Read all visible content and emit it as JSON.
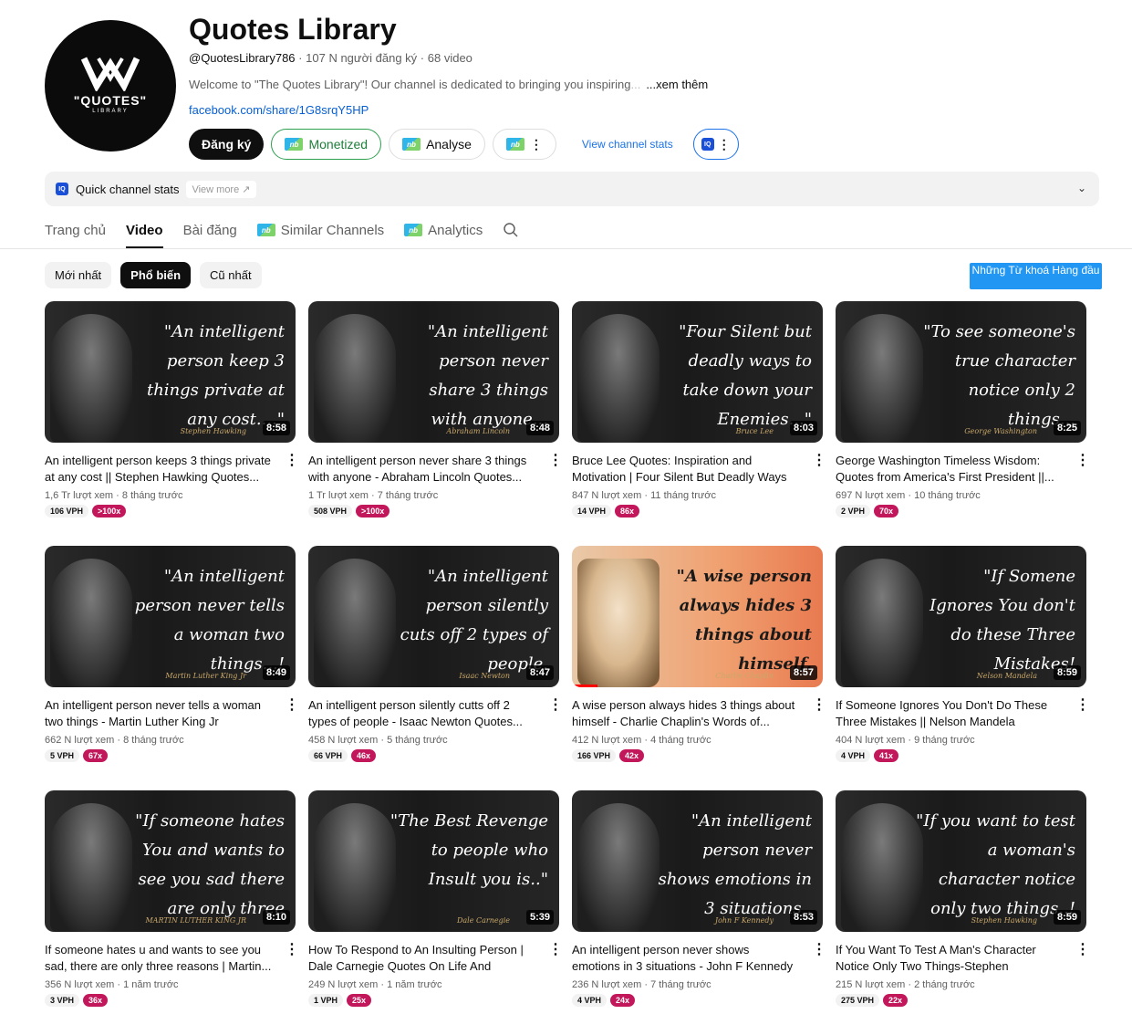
{
  "channel": {
    "title": "Quotes Library",
    "handle": "@QuotesLibrary786",
    "subscribers": "107 N người đăng ký",
    "video_count": "68 video",
    "sep": "·",
    "description": "Welcome to \"The Quotes Library\"! Our channel is dedicated to bringing you inspiring",
    "desc_fade": "...",
    "desc_more": "...xem thêm",
    "link": "facebook.com/share/1G8srqY5HP",
    "avatar_text": "\"QUOTES\"",
    "avatar_sub": "LIBRARY"
  },
  "buttons": {
    "subscribe": "Đăng ký",
    "monetized": "Monetized",
    "analyse": "Analyse",
    "view_stats": "View channel stats",
    "more": "⋮",
    "nb": "nb"
  },
  "stats_bar": {
    "label": "Quick channel stats",
    "view_more": "View more"
  },
  "tabs": [
    "Trang chủ",
    "Video",
    "Bài đăng",
    "Similar Channels",
    "Analytics"
  ],
  "chips": [
    "Mới nhất",
    "Phổ biến",
    "Cũ nhất"
  ],
  "keyword_button": "Những Từ khoá Hàng đầu",
  "videos": [
    {
      "title": "An intelligent person keeps 3 things private at any cost || Stephen Hawking Quotes...",
      "views": "1,6 Tr lượt xem",
      "age": "8 tháng trước",
      "vph": "106 VPH",
      "mult": ">100x",
      "dur": "8:58",
      "quote": "\"An intelligent person keep 3 things private at any cost....\"",
      "sig": "Stephen Hawking"
    },
    {
      "title": "An intelligent person never share 3 things with anyone - Abraham Lincoln Quotes...",
      "views": "1 Tr lượt xem",
      "age": "7 tháng trước",
      "vph": "508 VPH",
      "mult": ">100x",
      "dur": "8:48",
      "quote": "\"An intelligent person never share 3 things with anyone...",
      "sig": "Abraham Lincoln"
    },
    {
      "title": "Bruce Lee Quotes: Inspiration and Motivation | Four Silent But Deadly Ways To...",
      "views": "847 N lượt xem",
      "age": "11 tháng trước",
      "vph": "14 VPH",
      "mult": "86x",
      "dur": "8:03",
      "quote": "\"Four Silent but deadly ways to take down your Enemies...\"",
      "sig": "Bruce Lee"
    },
    {
      "title": "George Washington Timeless Wisdom: Quotes from America's First President ||...",
      "views": "697 N lượt xem",
      "age": "10 tháng trước",
      "vph": "2 VPH",
      "mult": "70x",
      "dur": "8:25",
      "quote": "\"To see someone's true character notice only 2 things...",
      "sig": "George Washington"
    },
    {
      "title": "An intelligent person never tells a woman two things - Martin Luther King Jr Powerful...",
      "views": "662 N lượt xem",
      "age": "8 tháng trước",
      "vph": "5 VPH",
      "mult": "67x",
      "dur": "8:49",
      "quote": "\"An intelligent person never tells a woman two things...!",
      "sig": "Martin Luther King Jr"
    },
    {
      "title": "An intelligent person silently cutts off 2 types of people - Isaac Newton Quotes...",
      "views": "458 N lượt xem",
      "age": "5 tháng trước",
      "vph": "66 VPH",
      "mult": "46x",
      "dur": "8:47",
      "quote": "\"An intelligent person silently cuts off 2 types of people.",
      "sig": "Isaac Newton"
    },
    {
      "title": "A wise person always hides 3 things about himself - Charlie Chaplin's Words of...",
      "views": "412 N lượt xem",
      "age": "4 tháng trước",
      "vph": "166 VPH",
      "mult": "42x",
      "dur": "8:57",
      "quote": "\"A wise person always hides 3 things about himself.",
      "sig": "Charlie Chaplin"
    },
    {
      "title": "If Someone Ignores You Don't Do These Three Mistakes || Nelson Mandela Quotes...",
      "views": "404 N lượt xem",
      "age": "9 tháng trước",
      "vph": "4 VPH",
      "mult": "41x",
      "dur": "8:59",
      "quote": "\"If Somene Ignores You don't do these Three Mistakes!",
      "sig": "Nelson Mandela"
    },
    {
      "title": "If someone hates u and wants to see you sad, there are only three reasons | Martin...",
      "views": "356 N lượt xem",
      "age": "1 năm trước",
      "vph": "3 VPH",
      "mult": "36x",
      "dur": "8:10",
      "quote": "\"If someone hates You and wants to see you sad there are only three reasons.",
      "sig": "MARTIN LUTHER KING JR"
    },
    {
      "title": "How To Respond to An Insulting Person | Dale Carnegie Quotes On Life And Success...",
      "views": "249 N lượt xem",
      "age": "1 năm trước",
      "vph": "1 VPH",
      "mult": "25x",
      "dur": "5:39",
      "quote": "\"The Best Revenge to people who Insult you is..\"",
      "sig": "Dale Carnegie"
    },
    {
      "title": "An intelligent person never shows emotions in 3 situations - John F Kennedy Quotes...",
      "views": "236 N lượt xem",
      "age": "7 tháng trước",
      "vph": "4 VPH",
      "mult": "24x",
      "dur": "8:53",
      "quote": "\"An intelligent person never shows emotions in 3 situations .",
      "sig": "John F Kennedy"
    },
    {
      "title": "If You Want To Test A Man's Character Notice Only Two Things-Stephen Hawking'...",
      "views": "215 N lượt xem",
      "age": "2 tháng trước",
      "vph": "275 VPH",
      "mult": "22x",
      "dur": "8:59",
      "quote": "\"If you want to test a woman's character notice only two things..!",
      "sig": "Stephen Hawking"
    }
  ]
}
